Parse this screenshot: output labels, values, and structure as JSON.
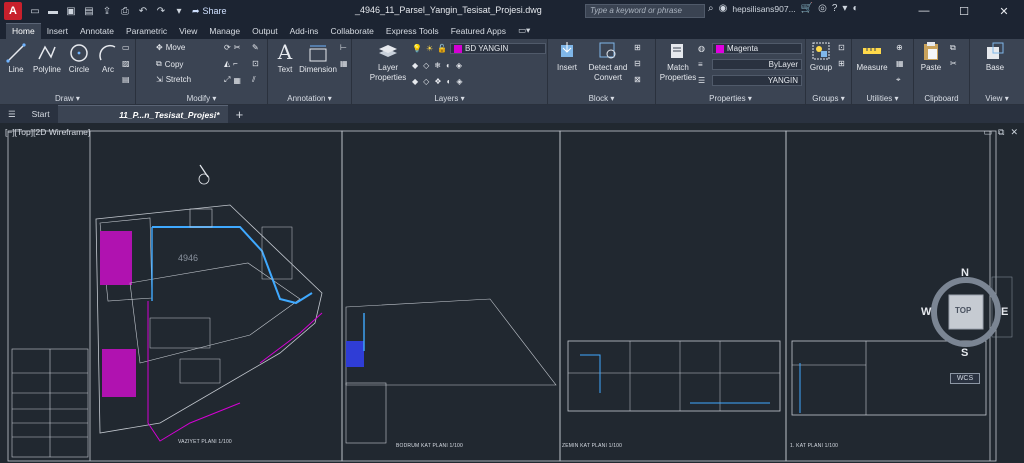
{
  "app": {
    "logo": "A",
    "document_title": "_4946_11_Parsel_Yangin_Tesisat_Projesi.dwg",
    "share_label": "Share",
    "search_placeholder": "Type a keyword or phrase",
    "user": "hepsilisans907...",
    "help": "?"
  },
  "ribbon_tabs": [
    "Home",
    "Insert",
    "Annotate",
    "Parametric",
    "View",
    "Manage",
    "Output",
    "Add-ins",
    "Collaborate",
    "Express Tools",
    "Featured Apps"
  ],
  "ribbon": {
    "draw": {
      "title": "Draw",
      "line": "Line",
      "polyline": "Polyline",
      "circle": "Circle",
      "arc": "Arc"
    },
    "modify": {
      "title": "Modify",
      "move": "Move",
      "copy": "Copy",
      "stretch": "Stretch"
    },
    "annotation": {
      "title": "Annotation",
      "text": "Text",
      "dimension": "Dimension"
    },
    "layers": {
      "title": "Layers",
      "layer_properties": "Layer Properties",
      "current_layer": "BD YANGIN",
      "layer_color": "#d400d4"
    },
    "block": {
      "title": "Block",
      "insert": "Insert",
      "detect_convert": "Detect and Convert"
    },
    "properties": {
      "title": "Properties",
      "match_properties": "Match Properties",
      "color": "Magenta",
      "color_hex": "#e000e0",
      "linetype": "ByLayer",
      "lineweight": "YANGIN"
    },
    "groups": {
      "title": "Groups",
      "group": "Group"
    },
    "utilities": {
      "title": "Utilities",
      "measure": "Measure"
    },
    "clipboard": {
      "title": "Clipboard",
      "paste": "Paste"
    },
    "view": {
      "title": "View",
      "base": "Base"
    }
  },
  "doc_tabs": {
    "start": "Start",
    "active": "11_P...n_Tesisat_Projesi*",
    "add": "+"
  },
  "viewport": {
    "label": "[−][Top][2D Wireframe]",
    "viewcube": {
      "top": "TOP",
      "n": "N",
      "s": "S",
      "e": "E",
      "w": "W"
    },
    "wcs": "WCS"
  },
  "drawing": {
    "parcel_number": "4946",
    "sheet1_caption": "VAZIYET PLANI  1/100",
    "sheet2_caption": "BODRUM KAT PLANI 1/100",
    "sheet3_caption": "ZEMIN KAT PLANI 1/100",
    "sheet4_caption": "1. KAT PLANI 1/100"
  }
}
